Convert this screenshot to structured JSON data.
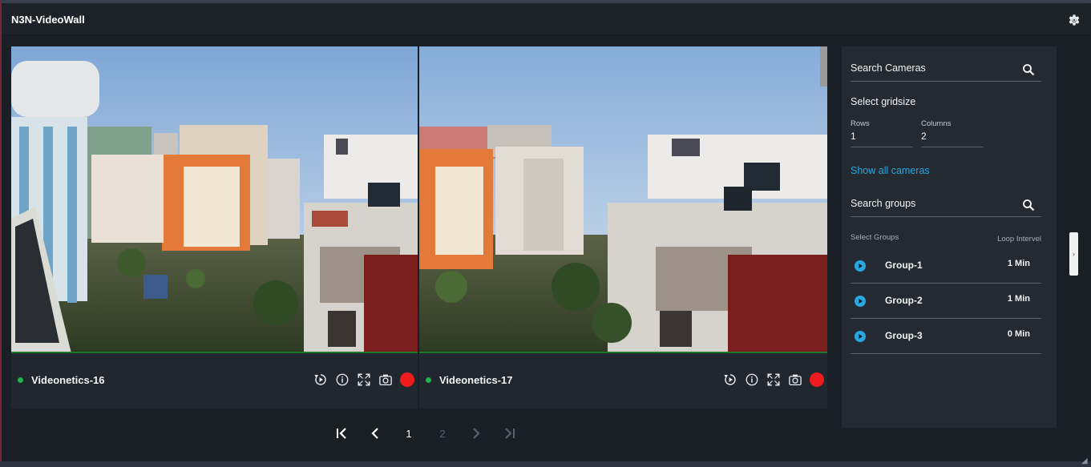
{
  "app": {
    "title": "N3N-VideoWall"
  },
  "icons": {
    "settings": "gear-icon",
    "playback": "playback-icon",
    "info": "info-icon",
    "fullscreen": "fullscreen-icon",
    "snapshot": "camera-icon",
    "record": "record-icon",
    "search": "search-icon",
    "play": "play-icon"
  },
  "colors": {
    "online": "#22b14c",
    "record": "#ee1c1c",
    "accent": "#29a8e0"
  },
  "cameras": [
    {
      "name": "Videonetics-16",
      "status": "online"
    },
    {
      "name": "Videonetics-17",
      "status": "online"
    }
  ],
  "pagination": {
    "pages": [
      "1",
      "2"
    ],
    "current": "1"
  },
  "panel": {
    "search_cameras": "Search Cameras",
    "select_gridsize": "Select gridsize",
    "rows_label": "Rows",
    "rows_value": "1",
    "columns_label": "Columns",
    "columns_value": "2",
    "show_all": "Show all cameras",
    "search_groups": "Search groups",
    "select_groups": "Select Groups",
    "loop_interval": "Loop Intervel",
    "groups": [
      {
        "name": "Group-1",
        "interval": "1 Min"
      },
      {
        "name": "Group-2",
        "interval": "1 Min"
      },
      {
        "name": "Group-3",
        "interval": "0 Min"
      }
    ]
  }
}
